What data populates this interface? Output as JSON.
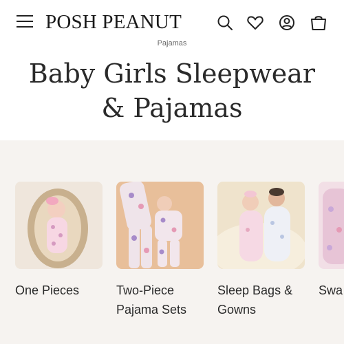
{
  "header": {
    "logo": "POSH PEANUT",
    "icons": [
      "menu-icon",
      "search-icon",
      "heart-icon",
      "account-icon",
      "shopping-bag-icon"
    ]
  },
  "breadcrumb": "Pajamas",
  "page": {
    "title": "Baby Girls Sleepwear & Pajamas"
  },
  "categories": [
    {
      "label_line1": "One Pieces",
      "label_line2": ""
    },
    {
      "label_line1": "Two-Piece",
      "label_line2": "Pajama Sets"
    },
    {
      "label_line1": "Sleep Bags &",
      "label_line2": "Gowns"
    },
    {
      "label_line1": "Swa",
      "label_line2": ""
    }
  ],
  "colors": {
    "section_bg": "#f6f3f0",
    "text": "#2a2a2a",
    "accent_pink": "#f2b8cf",
    "accent_lavender": "#c9a8d8"
  }
}
